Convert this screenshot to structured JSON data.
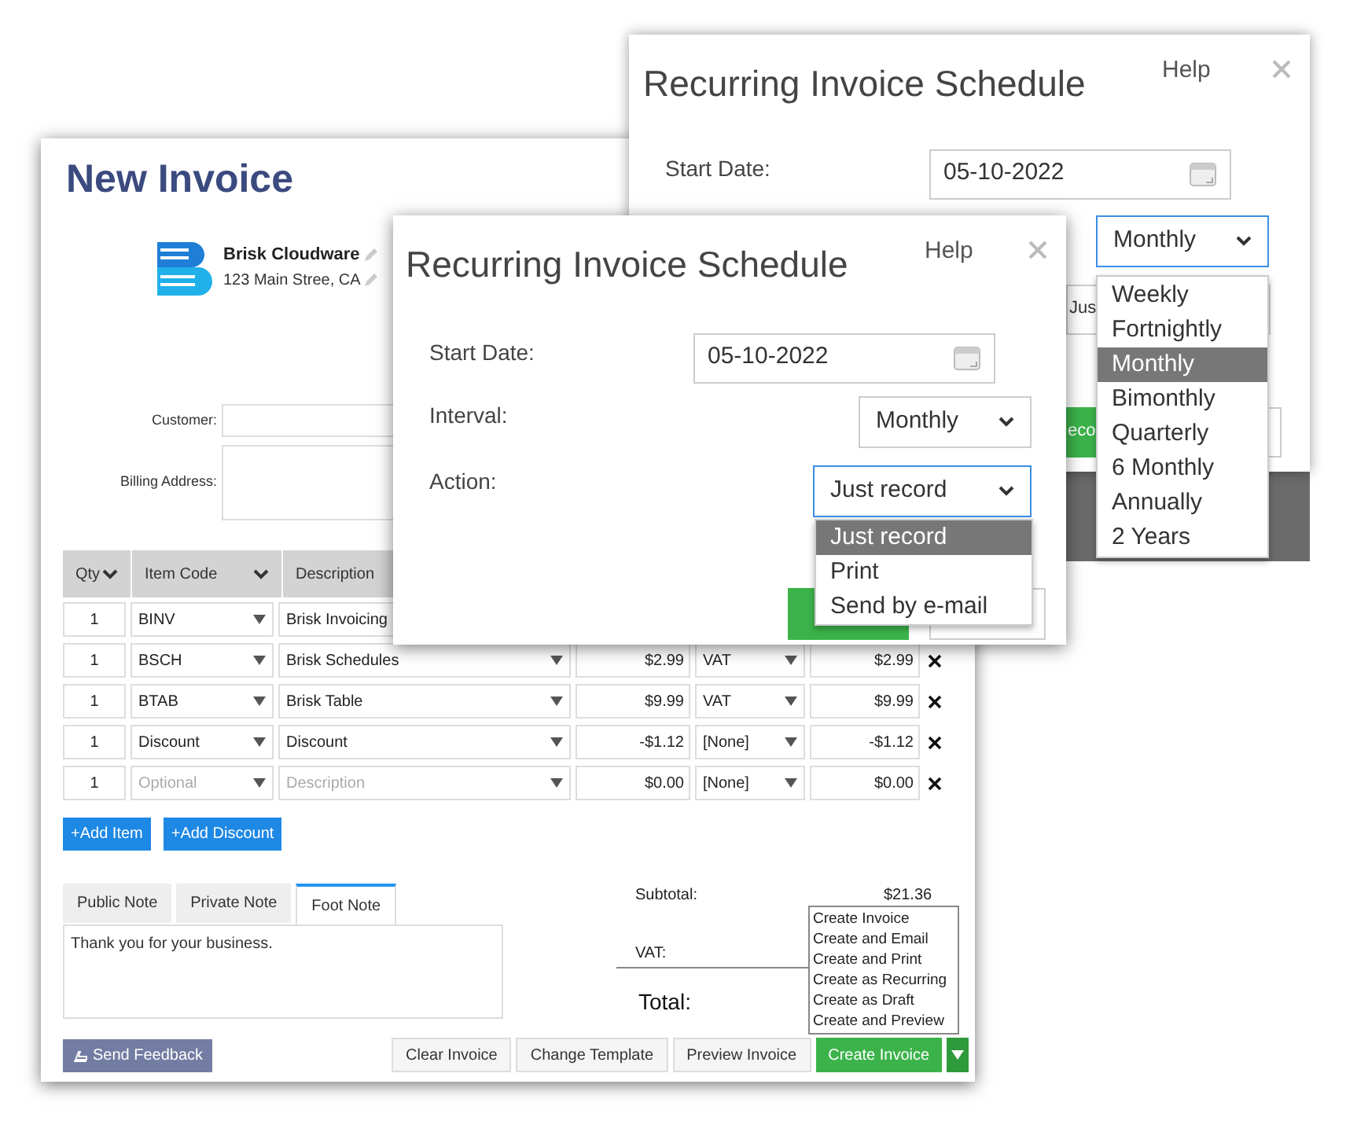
{
  "invoice": {
    "title": "New Invoice",
    "company": {
      "name": "Brisk Cloudware",
      "address": "123 Main Stree, CA"
    },
    "customer_label": "Customer:",
    "billing_label": "Billing Address:",
    "columns": [
      "Qty",
      "Item Code",
      "Description"
    ],
    "rows": [
      {
        "qty": "1",
        "item_code": "BINV",
        "description": "Brisk Invoicing"
      },
      {
        "qty": "1",
        "item_code": "BSCH",
        "description": "Brisk Schedules",
        "price": "$2.99",
        "tax": "VAT",
        "amount": "$2.99"
      },
      {
        "qty": "1",
        "item_code": "BTAB",
        "description": "Brisk Table",
        "price": "$9.99",
        "tax": "VAT",
        "amount": "$9.99"
      },
      {
        "qty": "1",
        "item_code": "Discount",
        "description": "Discount",
        "price": "-$1.12",
        "tax": "[None]",
        "amount": "-$1.12"
      },
      {
        "qty": "1",
        "item_code_placeholder": "Optional",
        "description_placeholder": "Description",
        "price": "$0.00",
        "tax": "[None]",
        "amount": "$0.00"
      }
    ],
    "add_buttons": [
      "+Add Item",
      "+Add Discount"
    ],
    "note_tabs": [
      {
        "label": "Public Note",
        "selected": false
      },
      {
        "label": "Private Note",
        "selected": false
      },
      {
        "label": "Foot Note",
        "selected": true
      }
    ],
    "note_text": "Thank you for your business.",
    "subtotal_label": "Subtotal:",
    "subtotal": "$21.36",
    "vat_label": "VAT:",
    "total_label": "Total:",
    "create_menu": [
      "Create Invoice",
      "Create and Email",
      "Create and Print",
      "Create as Recurring",
      "Create as Draft",
      "Create and Preview"
    ],
    "feedback_button": "Send Feedback",
    "buttons": [
      "Clear Invoice",
      "Change Template",
      "Preview Invoice"
    ],
    "create_button": "Create Invoice"
  },
  "schedule_dialog_back": {
    "title": "Recurring Invoice Schedule",
    "help": "Help",
    "start_date_label": "Start Date:",
    "start_date": "05-10-2022",
    "interval": "Monthly",
    "action": "Jus",
    "button_label": "eco",
    "interval_options": [
      {
        "label": "Weekly",
        "selected": false
      },
      {
        "label": "Fortnightly",
        "selected": false
      },
      {
        "label": "Monthly",
        "selected": true
      },
      {
        "label": "Bimonthly",
        "selected": false
      },
      {
        "label": "Quarterly",
        "selected": false
      },
      {
        "label": "6 Monthly",
        "selected": false
      },
      {
        "label": "Annually",
        "selected": false
      },
      {
        "label": "2 Years",
        "selected": false
      }
    ]
  },
  "schedule_dialog_front": {
    "title": "Recurring Invoice Schedule",
    "help": "Help",
    "start_date_label": "Start Date:",
    "start_date": "05-10-2022",
    "interval_label": "Interval:",
    "interval": "Monthly",
    "action_label": "Action:",
    "action": "Just record",
    "action_options": [
      {
        "label": "Just record",
        "selected": true
      },
      {
        "label": "Print",
        "selected": false
      },
      {
        "label": "Send by e-mail",
        "selected": false
      }
    ]
  }
}
